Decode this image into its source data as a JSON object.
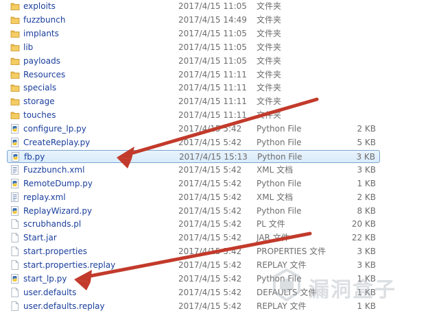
{
  "files": [
    {
      "name": "exploits",
      "date": "2017/4/15 11:05",
      "type": "文件夹",
      "size": "",
      "kind": "folder",
      "selected": false
    },
    {
      "name": "fuzzbunch",
      "date": "2017/4/15 14:49",
      "type": "文件夹",
      "size": "",
      "kind": "folder",
      "selected": false
    },
    {
      "name": "implants",
      "date": "2017/4/15 11:05",
      "type": "文件夹",
      "size": "",
      "kind": "folder",
      "selected": false
    },
    {
      "name": "lib",
      "date": "2017/4/15 11:05",
      "type": "文件夹",
      "size": "",
      "kind": "folder",
      "selected": false
    },
    {
      "name": "payloads",
      "date": "2017/4/15 11:05",
      "type": "文件夹",
      "size": "",
      "kind": "folder",
      "selected": false
    },
    {
      "name": "Resources",
      "date": "2017/4/15 11:11",
      "type": "文件夹",
      "size": "",
      "kind": "folder",
      "selected": false
    },
    {
      "name": "specials",
      "date": "2017/4/15 11:11",
      "type": "文件夹",
      "size": "",
      "kind": "folder",
      "selected": false
    },
    {
      "name": "storage",
      "date": "2017/4/15 11:11",
      "type": "文件夹",
      "size": "",
      "kind": "folder",
      "selected": false
    },
    {
      "name": "touches",
      "date": "2017/4/15 11:11",
      "type": "文件夹",
      "size": "",
      "kind": "folder",
      "selected": false
    },
    {
      "name": "configure_lp.py",
      "date": "2017/4/15 5:42",
      "type": "Python File",
      "size": "2 KB",
      "kind": "python",
      "selected": false
    },
    {
      "name": "CreateReplay.py",
      "date": "2017/4/15 5:42",
      "type": "Python File",
      "size": "5 KB",
      "kind": "python",
      "selected": false
    },
    {
      "name": "fb.py",
      "date": "2017/4/15 15:13",
      "type": "Python File",
      "size": "3 KB",
      "kind": "python",
      "selected": true
    },
    {
      "name": "Fuzzbunch.xml",
      "date": "2017/4/15 5:42",
      "type": "XML 文档",
      "size": "3 KB",
      "kind": "xml",
      "selected": false
    },
    {
      "name": "RemoteDump.py",
      "date": "2017/4/15 5:42",
      "type": "Python File",
      "size": "1 KB",
      "kind": "python",
      "selected": false
    },
    {
      "name": "replay.xml",
      "date": "2017/4/15 5:42",
      "type": "XML 文档",
      "size": "2 KB",
      "kind": "xml",
      "selected": false
    },
    {
      "name": "ReplayWizard.py",
      "date": "2017/4/15 5:42",
      "type": "Python File",
      "size": "8 KB",
      "kind": "python",
      "selected": false
    },
    {
      "name": "scrubhands.pl",
      "date": "2017/4/15 5:42",
      "type": "PL 文件",
      "size": "20 KB",
      "kind": "file",
      "selected": false
    },
    {
      "name": "Start.jar",
      "date": "2017/4/15 5:42",
      "type": "JAR 文件",
      "size": "22 KB",
      "kind": "file",
      "selected": false
    },
    {
      "name": "start.properties",
      "date": "2017/4/15 5:42",
      "type": "PROPERTIES 文件",
      "size": "3 KB",
      "kind": "file",
      "selected": false
    },
    {
      "name": "start.properties.replay",
      "date": "2017/4/15 5:42",
      "type": "REPLAY 文件",
      "size": "3 KB",
      "kind": "file",
      "selected": false
    },
    {
      "name": "start_lp.py",
      "date": "2017/4/15 5:42",
      "type": "Python File",
      "size": "1 KB",
      "kind": "python",
      "selected": false
    },
    {
      "name": "user.defaults",
      "date": "2017/4/15 5:42",
      "type": "DEFAULTS 文件",
      "size": "1 KB",
      "kind": "file",
      "selected": false
    },
    {
      "name": "user.defaults.replay",
      "date": "2017/4/15 5:42",
      "type": "REPLAY 文件",
      "size": "1 KB",
      "kind": "file",
      "selected": false
    }
  ],
  "icons": {
    "folder": "folder-icon",
    "python": "python-file-icon",
    "xml": "xml-file-icon",
    "file": "generic-file-icon"
  },
  "colors": {
    "name_text": "#1a3e9c",
    "meta_text": "#6d6d6d",
    "selection_border": "#7da2ce",
    "arrow": "#c0392b"
  },
  "watermark": {
    "text": "漏洞盒子"
  }
}
